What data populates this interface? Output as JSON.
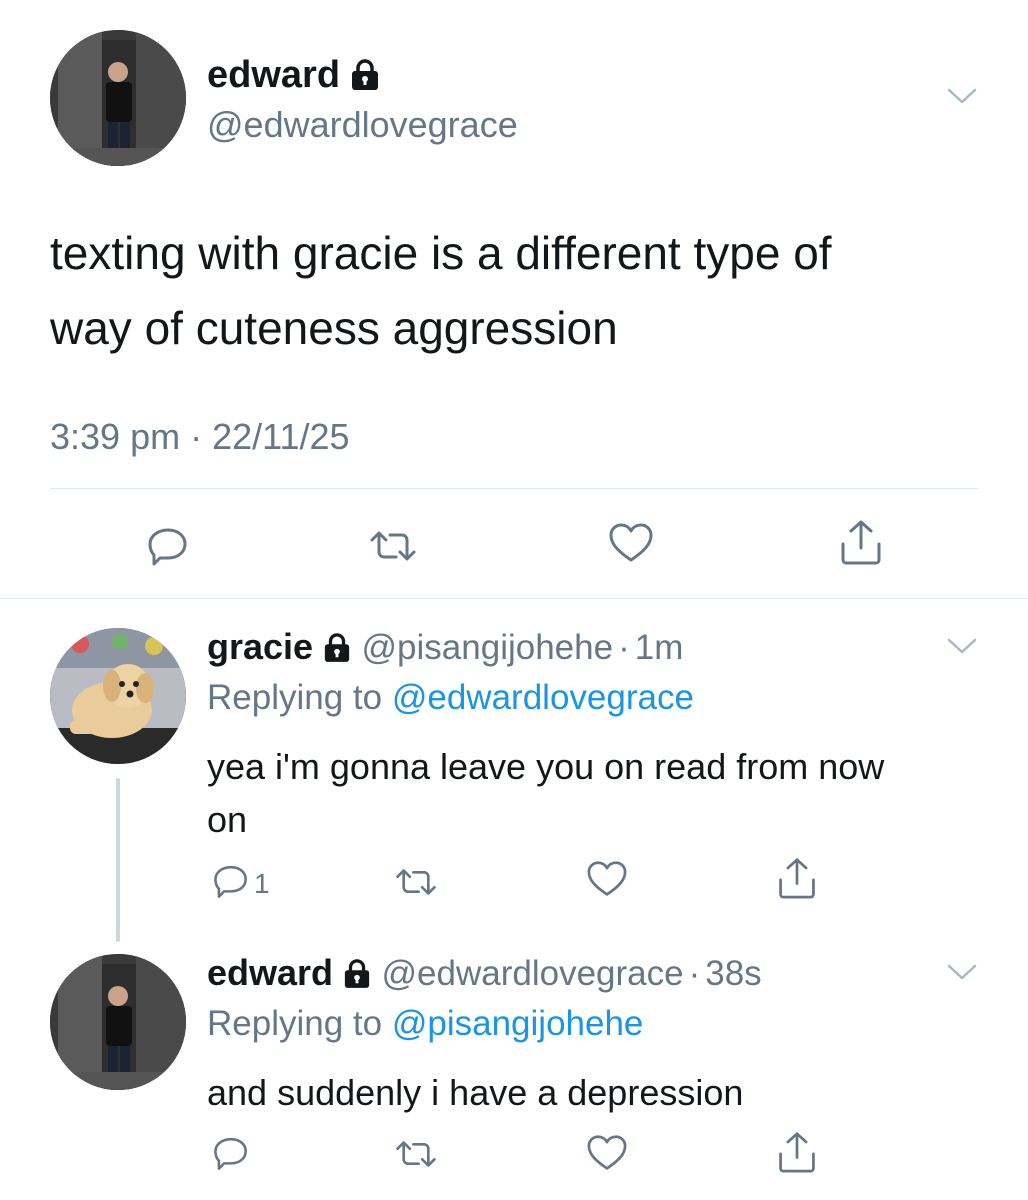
{
  "main_tweet": {
    "name": "edward",
    "handle": "@edwardlovegrace",
    "text_line1": "texting with gracie is a different type of",
    "text_line2": "way of cuteness aggression",
    "time": "3:39 pm",
    "date_sep": "·",
    "date": "22/11/25"
  },
  "replies": [
    {
      "name": "gracie",
      "handle": "@pisangijohehe",
      "sep": "·",
      "age": "1m",
      "replying_prefix": "Replying to",
      "replying_to": "@edwardlovegrace",
      "text_line1": "yea i'm gonna leave you on read from now",
      "text_line2": "on",
      "reply_count": "1"
    },
    {
      "name": "edward",
      "handle": "@edwardlovegrace",
      "sep": "·",
      "age": "38s",
      "replying_prefix": "Replying to",
      "replying_to": "@pisangijohehe",
      "text_line1": "and suddenly i have a depression"
    }
  ],
  "icons": [
    "lock-icon",
    "chevron-down-icon",
    "reply-icon",
    "retweet-icon",
    "like-icon",
    "share-icon"
  ],
  "colors": {
    "link": "#1b95e0",
    "secondary": "#657786",
    "divider": "#e1e8ed",
    "text": "#14171a"
  }
}
